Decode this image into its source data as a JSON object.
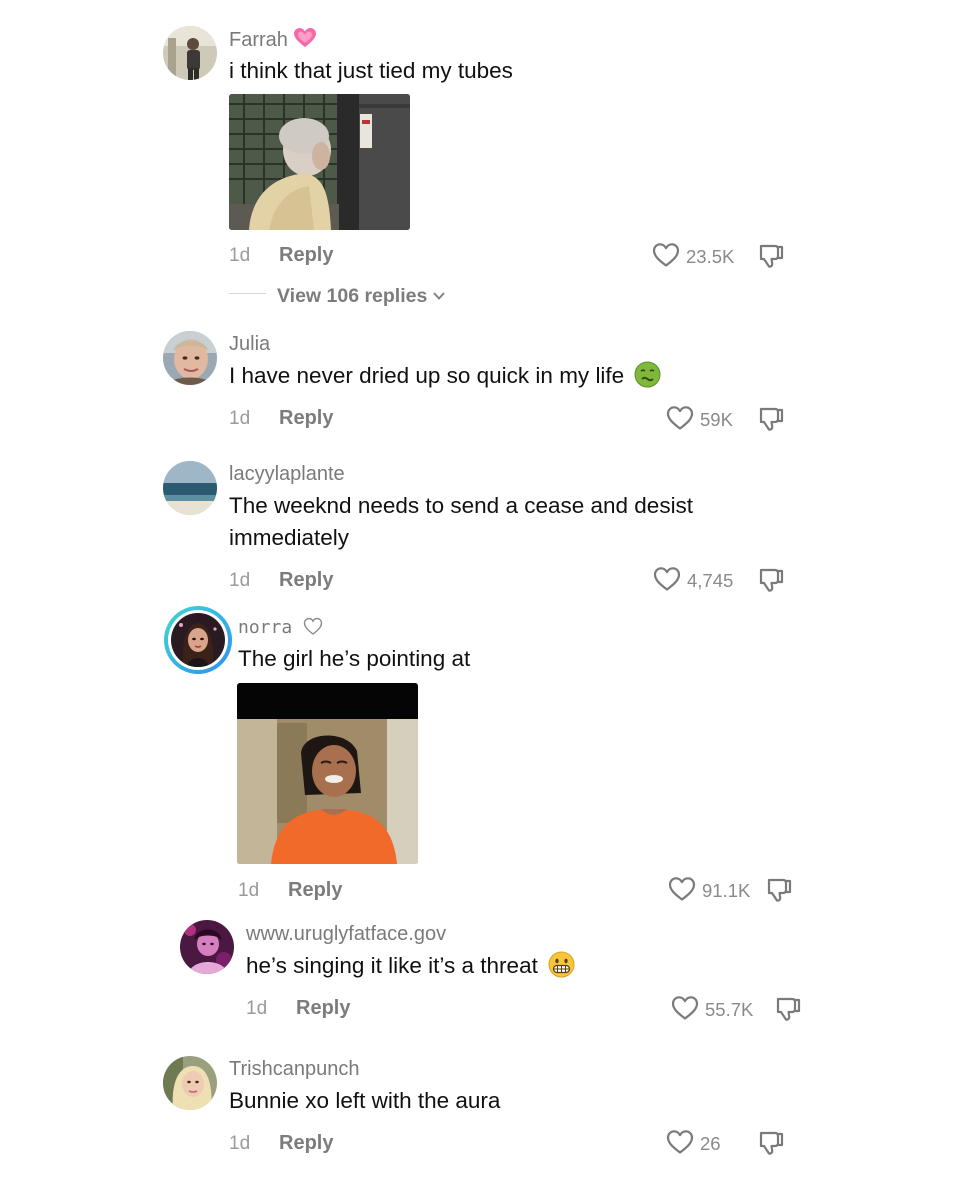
{
  "comments": [
    {
      "username": "Farrah",
      "text": "i think that just tied my tubes",
      "time": "1d",
      "reply_label": "Reply",
      "likes": "23.5K",
      "name_badge_icon": "pink-heart-icon"
    },
    {
      "username": "Julia",
      "text": "I have never dried up so quick in my life",
      "time": "1d",
      "reply_label": "Reply",
      "likes": "59K",
      "emoji_icon": "nauseated-face-icon"
    },
    {
      "username": "lacyylaplante",
      "text": "The weeknd needs to send a cease and desist immediately",
      "time": "1d",
      "reply_label": "Reply",
      "likes": "4,745"
    },
    {
      "username": "norra",
      "text": "The girl he’s pointing at",
      "time": "1d",
      "reply_label": "Reply",
      "likes": "91.1K",
      "name_badge_icon": "outline-heart-icon"
    },
    {
      "username": "www.uruglyfatface.gov",
      "text": "he’s singing it like it’s a threat",
      "time": "1d",
      "reply_label": "Reply",
      "likes": "55.7K",
      "emoji_icon": "grimacing-face-icon"
    },
    {
      "username": "Trishcanpunch",
      "text": "Bunnie xo left with the aura",
      "time": "1d",
      "reply_label": "Reply",
      "likes": "26"
    }
  ],
  "view_replies": "View 106 replies",
  "colors": {
    "username": "#7a7a7a",
    "text": "#111111",
    "muted": "#9a9a9a",
    "story_ring_start": "#3fd9d1",
    "story_ring_end": "#2f8ff0"
  }
}
